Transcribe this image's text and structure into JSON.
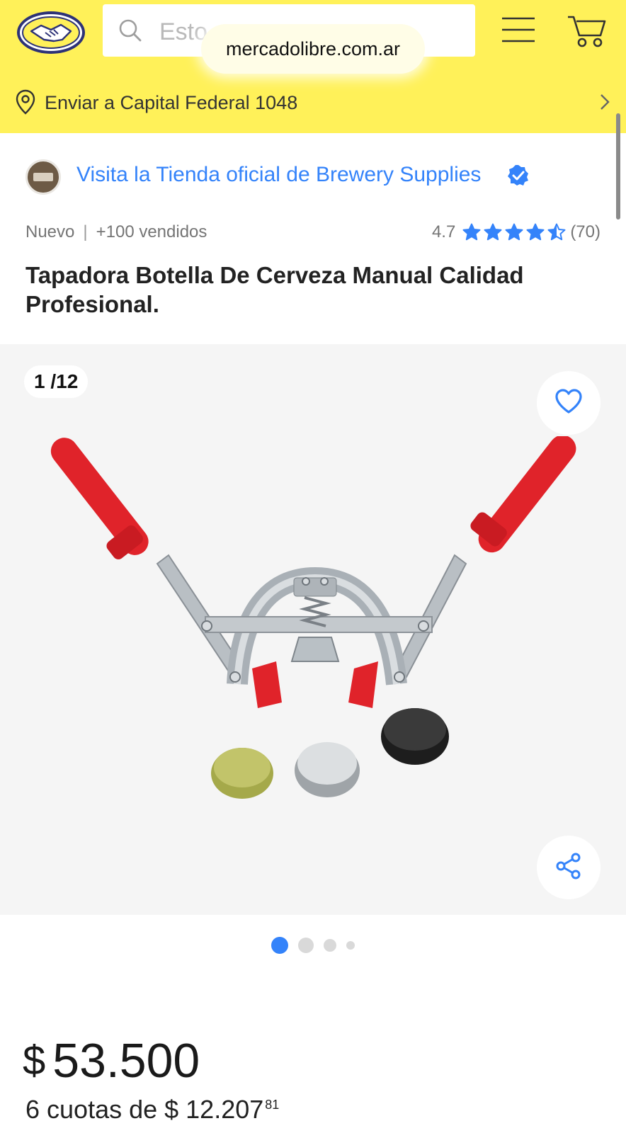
{
  "browser": {
    "url": "mercadolibre.com.ar"
  },
  "header": {
    "search_placeholder": "Esto",
    "shipping": "Enviar a Capital Federal 1048",
    "logo_icon": "handshake-logo-icon",
    "menu_icon": "hamburger-menu-icon",
    "cart_icon": "cart-icon",
    "colors": {
      "brand_yellow": "#fff159",
      "link_blue": "#3483fa"
    }
  },
  "store": {
    "label": "Visita la Tienda oficial de Brewery Supplies",
    "verified_icon": "verified-badge-icon"
  },
  "product": {
    "condition": "Nuevo",
    "separator": "|",
    "sold": "+100 vendidos",
    "rating_score": "4.7",
    "rating_value": 4.7,
    "rating_max": 5,
    "review_count": "(70)",
    "title": "Tapadora Botella De Cerveza Manual Calidad Profesional."
  },
  "gallery": {
    "counter": "1 /12",
    "current_image": 1,
    "total_images": 12,
    "visible_dots": 4,
    "active_dot": 0,
    "fav_icon": "heart-icon",
    "share_icon": "share-icon"
  },
  "price": {
    "currency": "$",
    "amount": "53.500",
    "installments_text": "6 cuotas de $ 12.207",
    "installments_cents": "81"
  }
}
